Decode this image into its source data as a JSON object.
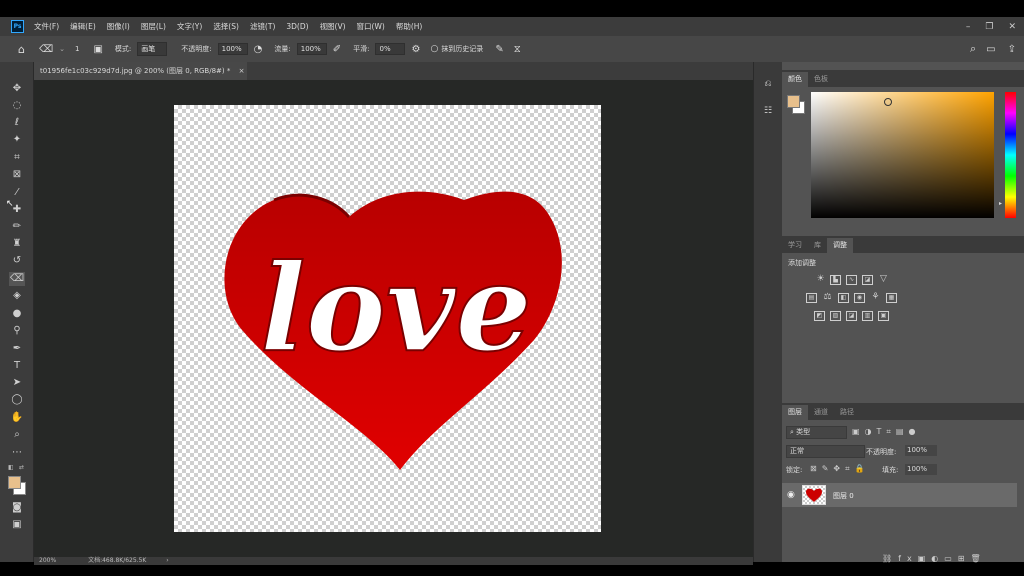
{
  "menu": {
    "items": [
      "文件(F)",
      "编辑(E)",
      "图像(I)",
      "图层(L)",
      "文字(Y)",
      "选择(S)",
      "滤镜(T)",
      "3D(D)",
      "视图(V)",
      "窗口(W)",
      "帮助(H)"
    ],
    "logo": "Ps"
  },
  "window_controls": {
    "minimize": "–",
    "restore": "❐",
    "close": "✕"
  },
  "options": {
    "mode_label": "模式:",
    "mode_value": "画笔",
    "opacity_label": "不透明度:",
    "opacity_value": "100%",
    "flow_label": "流量:",
    "flow_value": "100%",
    "smooth_label": "平滑:",
    "smooth_value": "0%",
    "erase_history_label": "抹到历史记录",
    "brush_size": "1"
  },
  "document": {
    "tab_title": "t01956fe1c03c929d7d.jpg @ 200% (图层 0, RGB/8#) *",
    "close": "×",
    "artwork_text": "love"
  },
  "status": {
    "zoom": "200%",
    "doc_info": "文档:468.8K/625.5K"
  },
  "color_panel": {
    "tabs": [
      "颜色",
      "色板"
    ],
    "foreground": "#e8c08c",
    "background": "#ffffff"
  },
  "adjust_panel": {
    "tabs": [
      "学习",
      "库",
      "调整"
    ],
    "title": "添加调整"
  },
  "layers_panel": {
    "tabs": [
      "图层",
      "通道",
      "路径"
    ],
    "filter_label": "类型",
    "blend_mode": "正常",
    "opacity_label": "不透明度:",
    "opacity_value": "100%",
    "lock_label": "锁定:",
    "fill_label": "填充:",
    "fill_value": "100%",
    "layer_name": "图层 0"
  },
  "colors": {
    "accent": "#cc0000",
    "heart_dark": "#a80000"
  }
}
